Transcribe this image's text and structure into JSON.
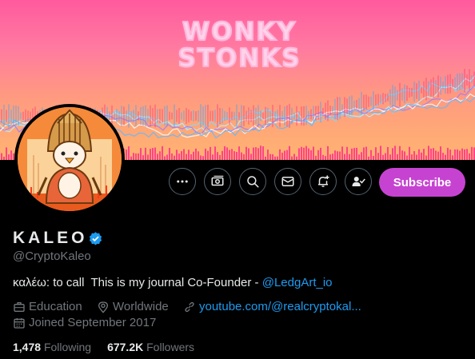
{
  "banner": {
    "title_line1": "WONKY",
    "title_line2": "STONKS"
  },
  "actions": {
    "more_icon": "more-icon",
    "tips_icon": "money-icon",
    "search_icon": "search-icon",
    "message_icon": "mail-icon",
    "notify_icon": "bell-plus-icon",
    "follow_icon": "person-check-icon",
    "subscribe_label": "Subscribe"
  },
  "profile": {
    "name": "KALEO",
    "handle": "@CryptoKaleo",
    "bio_text": "καλέω: to call  This is my journal Co-Founder - ",
    "bio_link": "@LedgArt_io",
    "category": "Education",
    "location": "Worldwide",
    "website": "youtube.com/@realcryptokal...",
    "joined": "Joined September 2017"
  },
  "stats": {
    "following_count": "1,478",
    "following_label": "Following",
    "followers_count": "677.2K",
    "followers_label": "Followers"
  },
  "colors": {
    "accent": "#1d9bf0",
    "subscribe": "#c643d1",
    "muted": "#71767b"
  }
}
